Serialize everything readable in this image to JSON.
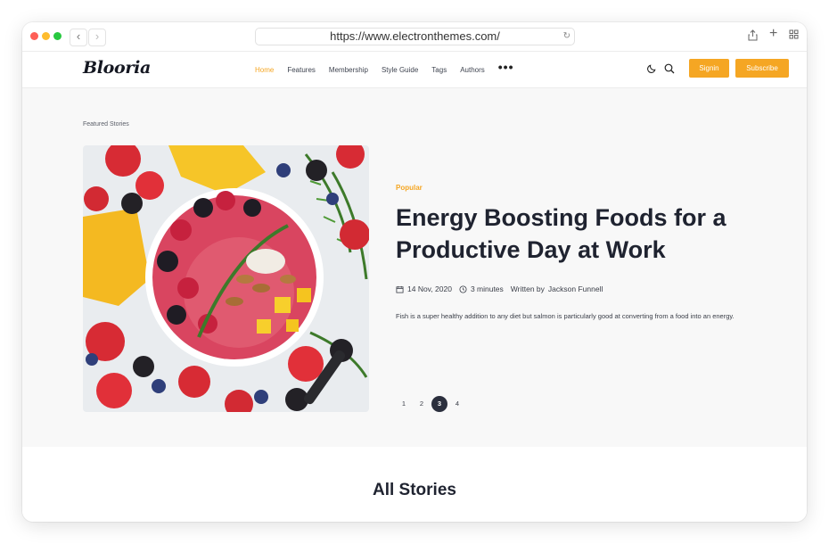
{
  "browser": {
    "url": "https://www.electronthemes.com/"
  },
  "header": {
    "logo": "Blooria",
    "menu": [
      {
        "label": "Home",
        "active": true
      },
      {
        "label": "Features"
      },
      {
        "label": "Membership"
      },
      {
        "label": "Style Guide"
      },
      {
        "label": "Tags"
      },
      {
        "label": "Authors"
      }
    ],
    "more_label": "•••",
    "signin_label": "Signin",
    "subscribe_label": "Subscribe",
    "accent_color": "#f5a623"
  },
  "featured": {
    "section_label": "Featured Stories",
    "category": "Popular",
    "title": "Energy Boosting Foods for a Productive Day at Work",
    "date": "14 Nov, 2020",
    "read_time": "3 minutes",
    "written_by": "Written by",
    "author": "Jackson Funnell",
    "excerpt": "Fish is a super healthy addition to any diet but salmon is particularly good at converting from a food into an energy.",
    "pages": [
      "1",
      "2",
      "3",
      "4"
    ],
    "current_page": "3"
  },
  "all_stories": {
    "heading": "All Stories"
  }
}
